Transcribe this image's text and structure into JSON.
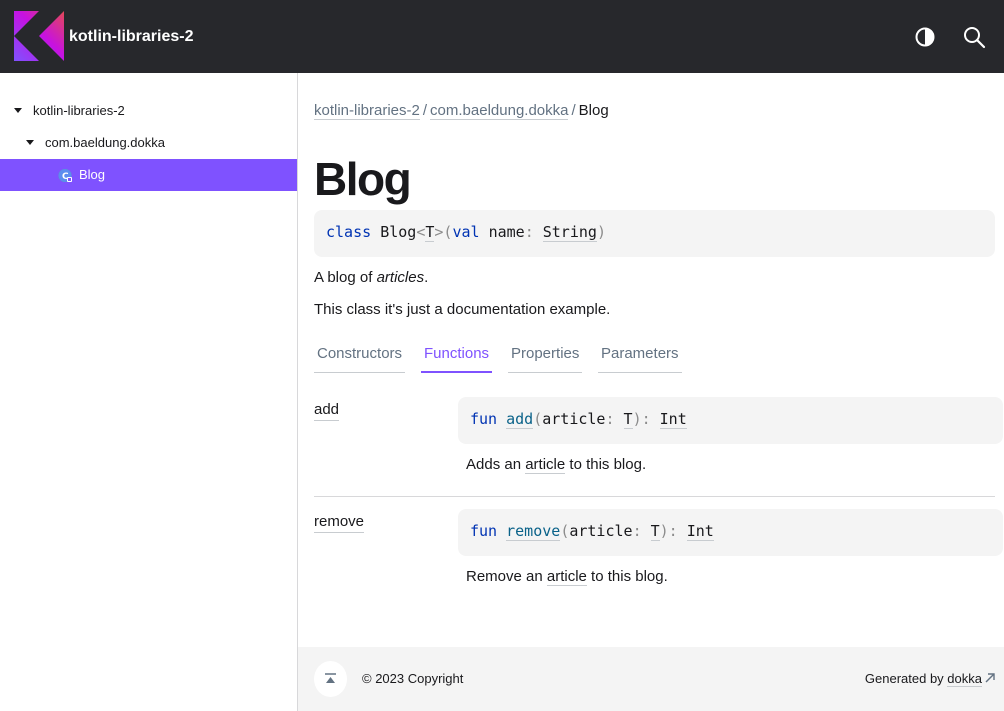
{
  "header": {
    "project_name": "kotlin-libraries-2",
    "logo": "kotlin-logo",
    "theme_icon": "theme-toggle-icon",
    "search_icon": "search-icon"
  },
  "sidebar": {
    "items": [
      {
        "label": "kotlin-libraries-2",
        "level": 0,
        "expanded": true,
        "selected": false
      },
      {
        "label": "com.baeldung.dokka",
        "level": 1,
        "expanded": true,
        "selected": false
      },
      {
        "label": "Blog",
        "level": 2,
        "icon": "class-generic-icon",
        "selected": true
      }
    ]
  },
  "breadcrumb": {
    "items": [
      "kotlin-libraries-2",
      "com.baeldung.dokka"
    ],
    "separator": "/",
    "current": "Blog"
  },
  "page": {
    "title": "Blog",
    "signature": {
      "keyword": "class",
      "name": "Blog",
      "type_param": "T",
      "val_keyword": "val",
      "param_name": "name",
      "param_type": "String"
    },
    "description_prefix": "A blog of ",
    "description_em": "articles",
    "description_suffix": ".",
    "description_2": "This class it's just a documentation example."
  },
  "tabs": [
    {
      "label": "Constructors",
      "active": false
    },
    {
      "label": "Functions",
      "active": true
    },
    {
      "label": "Properties",
      "active": false
    },
    {
      "label": "Parameters",
      "active": false
    }
  ],
  "functions": [
    {
      "name": "add",
      "keyword": "fun",
      "param": "article",
      "param_type": "T",
      "return_type": "Int",
      "desc_prefix": "Adds an ",
      "desc_link": "article",
      "desc_suffix": " to this blog."
    },
    {
      "name": "remove",
      "keyword": "fun",
      "param": "article",
      "param_type": "T",
      "return_type": "Int",
      "desc_prefix": "Remove an ",
      "desc_link": "article",
      "desc_suffix": " to this blog."
    }
  ],
  "footer": {
    "copyright": "© 2023 Copyright",
    "generated_by": "Generated by ",
    "dokka_link": "dokka"
  },
  "colors": {
    "header_bg": "#27282c",
    "accent": "#7f52ff",
    "code_bg": "#f4f4f4",
    "keyword": "#0033b3",
    "function_name": "#0a6289"
  }
}
